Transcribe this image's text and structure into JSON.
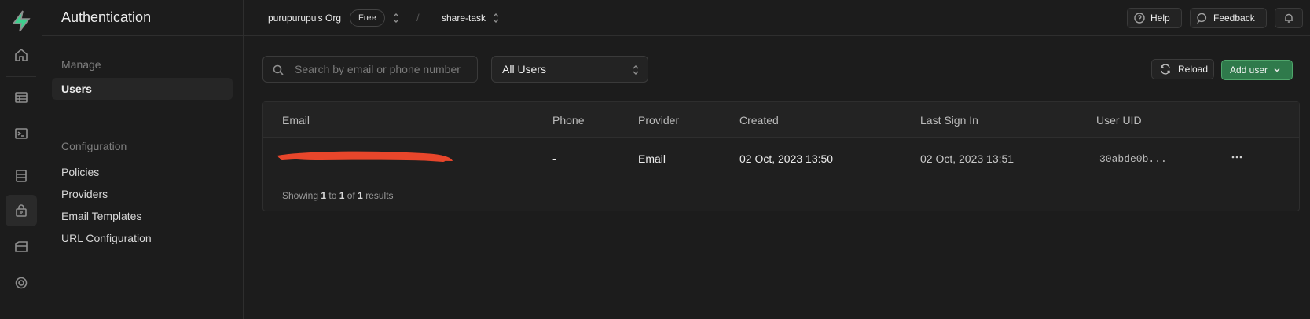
{
  "colors": {
    "accent": "#3ecf8e",
    "primary_button": "#2f7a4b",
    "redaction": "#e8462b"
  },
  "rail": {
    "logo": "supabase-logo",
    "items": [
      {
        "icon": "home-icon"
      },
      {
        "icon": "table-editor-icon"
      },
      {
        "icon": "sql-editor-icon"
      },
      {
        "icon": "database-icon"
      },
      {
        "icon": "authentication-icon",
        "active": true
      },
      {
        "icon": "storage-icon"
      },
      {
        "icon": "realtime-icon"
      }
    ]
  },
  "menu": {
    "title": "Authentication",
    "manage_label": "Manage",
    "manage_items": [
      "Users"
    ],
    "config_label": "Configuration",
    "config_items": [
      "Policies",
      "Providers",
      "Email Templates",
      "URL Configuration"
    ]
  },
  "topbar": {
    "org": "purupurupu's Org",
    "plan": "Free",
    "separator": "/",
    "project": "share-task",
    "help": "Help",
    "feedback": "Feedback"
  },
  "toolbar": {
    "search_placeholder": "Search by email or phone number",
    "filter_value": "All Users",
    "reload": "Reload",
    "add_user": "Add user"
  },
  "table": {
    "columns": [
      "Email",
      "Phone",
      "Provider",
      "Created",
      "Last Sign In",
      "User UID"
    ],
    "rows": [
      {
        "email": "",
        "phone": "-",
        "provider": "Email",
        "created": "02 Oct, 2023 13:50",
        "last_sign_in": "02 Oct, 2023 13:51",
        "uid": "30abde0b..."
      }
    ],
    "footer": {
      "prefix": "Showing",
      "from": "1",
      "to_word": "to",
      "to": "1",
      "of_word": "of",
      "total": "1",
      "suffix": "results"
    }
  }
}
